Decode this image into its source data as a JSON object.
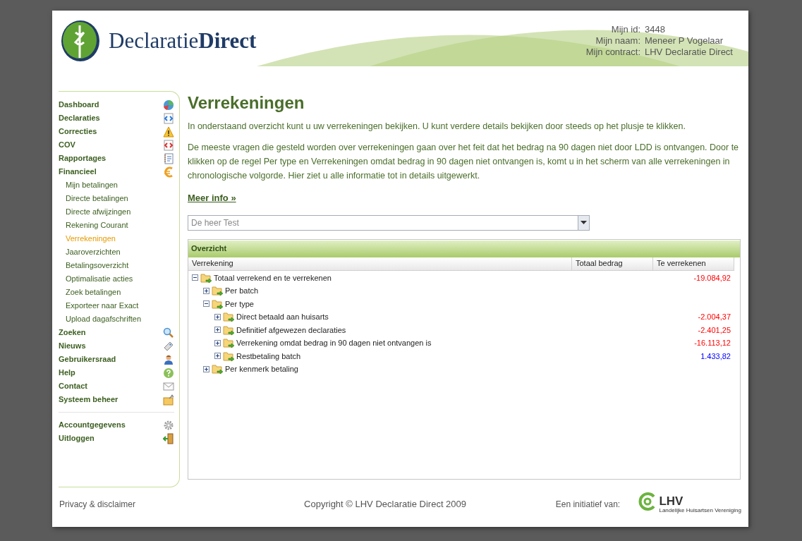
{
  "logo": {
    "text": "Declaratie**Direct**"
  },
  "account": [
    {
      "label": "Mijn id:",
      "value": "3448"
    },
    {
      "label": "Mijn naam:",
      "value": "Meneer P Vogelaar"
    },
    {
      "label": "Mijn contract:",
      "value": "LHV Declaratie Direct"
    }
  ],
  "sidebar": {
    "items": [
      {
        "label": "Dashboard",
        "kind": "main",
        "selected": false
      },
      {
        "label": "Declaraties",
        "kind": "main",
        "selected": false
      },
      {
        "label": "Correcties",
        "kind": "main",
        "selected": false
      },
      {
        "label": "COV",
        "kind": "main",
        "selected": false
      },
      {
        "label": "Rapportages",
        "kind": "main",
        "selected": false
      },
      {
        "label": "Financieel",
        "kind": "main",
        "selected": false
      },
      {
        "label": "Mijn betalingen",
        "kind": "sub",
        "selected": false
      },
      {
        "label": "Directe betalingen",
        "kind": "sub",
        "selected": false
      },
      {
        "label": "Directe afwijzingen",
        "kind": "sub",
        "selected": false
      },
      {
        "label": "Rekening Courant",
        "kind": "sub",
        "selected": false
      },
      {
        "label": "Verrekeningen",
        "kind": "sub",
        "selected": true
      },
      {
        "label": "Jaaroverzichten",
        "kind": "sub",
        "selected": false
      },
      {
        "label": "Betalingsoverzicht",
        "kind": "sub",
        "selected": false
      },
      {
        "label": "Optimalisatie acties",
        "kind": "sub",
        "selected": false
      },
      {
        "label": "Zoek betalingen",
        "kind": "sub",
        "selected": false
      },
      {
        "label": "Exporteer naar Exact",
        "kind": "sub",
        "selected": false
      },
      {
        "label": "Upload dagafschriften",
        "kind": "sub",
        "selected": false
      },
      {
        "label": "Zoeken",
        "kind": "main",
        "selected": false
      },
      {
        "label": "Nieuws",
        "kind": "main",
        "selected": false
      },
      {
        "label": "Gebruikersraad",
        "kind": "main",
        "selected": false
      },
      {
        "label": "Help",
        "kind": "main",
        "selected": false
      },
      {
        "label": "Contact",
        "kind": "main",
        "selected": false
      },
      {
        "label": "Systeem beheer",
        "kind": "main",
        "selected": false
      },
      {
        "kind": "divider"
      },
      {
        "label": "Accountgegevens",
        "kind": "main",
        "selected": false
      },
      {
        "label": "Uitloggen",
        "kind": "main",
        "selected": false
      }
    ]
  },
  "content": {
    "title": "Verrekeningen",
    "paragraphs": [
      "In onderstaand overzicht kunt u uw verrekeningen bekijken. U kunt verdere details bekijken door steeds op het plusje te klikken.",
      "De meeste vragen die gesteld worden over verrekeningen gaan over het feit dat het bedrag na 90 dagen niet door LDD is ontvangen. Door te klikken op de regel Per type en Verrekeningen omdat bedrag in 90 dagen niet ontvangen is, komt u in het scherm van alle verrekeningen in chronologische volgorde. Hier ziet u alle informatie tot in details uitgewerkt."
    ],
    "more_link": "Meer info »",
    "select": {
      "value": "De heer Test"
    },
    "panel": {
      "title": "Overzicht",
      "columns": [
        "Verrekening",
        "Totaal bedrag",
        "Te verrekenen"
      ],
      "tree": [
        {
          "label": "Totaal verrekend en te verrekenen",
          "amount": "-19.084,92",
          "color": "#ff0000",
          "expanded": true,
          "children": [
            {
              "label": "Per batch",
              "expanded": false
            },
            {
              "label": "Per type",
              "expanded": true,
              "children": [
                {
                  "label": "Direct betaald aan huisarts",
                  "amount": "-2.004,37",
                  "color": "#ff0000",
                  "expanded": false
                },
                {
                  "label": "Definitief afgewezen declaraties",
                  "amount": "-2.401,25",
                  "color": "#ff0000",
                  "expanded": false
                },
                {
                  "label": "Verrekening omdat bedrag in 90 dagen niet ontvangen is",
                  "amount": "-16.113,12",
                  "color": "#ff0000",
                  "expanded": false
                },
                {
                  "label": "Restbetaling batch",
                  "amount": "1.433,82",
                  "color": "#0000ff",
                  "expanded": false
                }
              ]
            },
            {
              "label": "Per kenmerk betaling",
              "expanded": false
            }
          ]
        }
      ]
    }
  },
  "footer": {
    "privacy": "Privacy & disclaimer",
    "copyright": "Copyright © LHV Declaratie Direct 2009",
    "initiative": "Een initiatief van:",
    "partner_logo": {
      "name": "LHV",
      "subtitle": "Landelijke Huisartsen Vereniging"
    }
  }
}
